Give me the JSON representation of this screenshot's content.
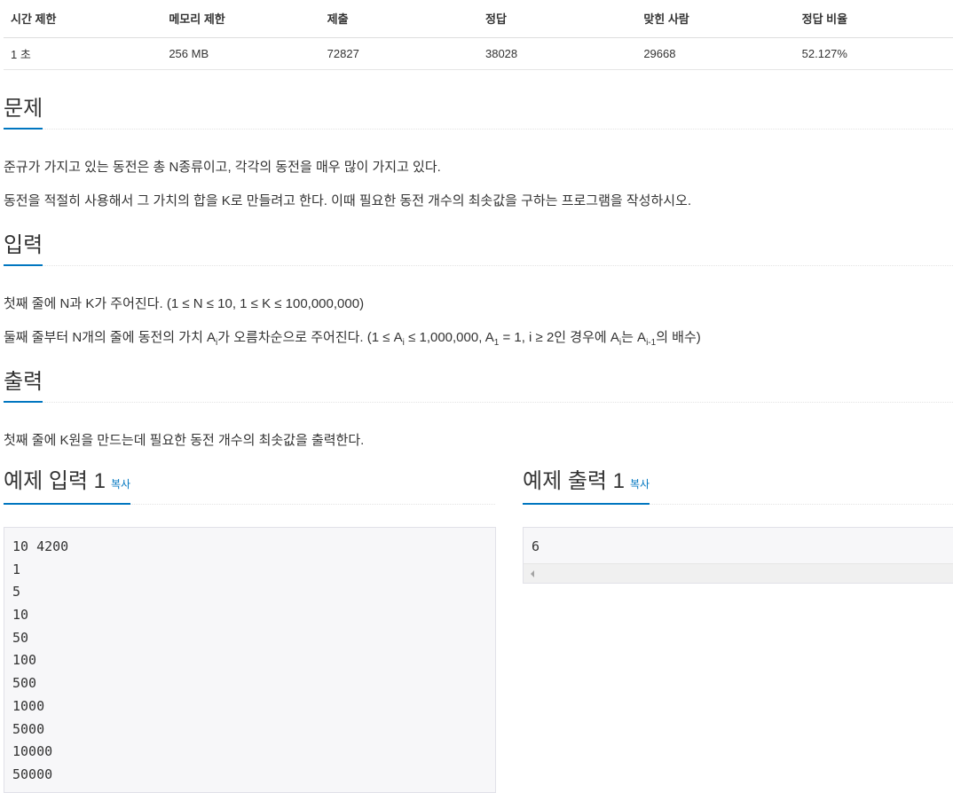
{
  "stats": {
    "headers": [
      "시간 제한",
      "메모리 제한",
      "제출",
      "정답",
      "맞힌 사람",
      "정답 비율"
    ],
    "values": [
      "1 초",
      "256 MB",
      "72827",
      "38028",
      "29668",
      "52.127%"
    ]
  },
  "problem": {
    "title": "문제",
    "p1": "준규가 가지고 있는 동전은 총 N종류이고, 각각의 동전을 매우 많이 가지고 있다.",
    "p2": "동전을 적절히 사용해서 그 가치의 합을 K로 만들려고 한다. 이때 필요한 동전 개수의 최솟값을 구하는 프로그램을 작성하시오."
  },
  "input": {
    "title": "입력",
    "p1": "첫째 줄에 N과 K가 주어진다. (1 ≤ N ≤ 10, 1 ≤ K ≤ 100,000,000)",
    "p2": {
      "t1": "둘째 줄부터 N개의 줄에 동전의 가치 A",
      "s1": "i",
      "t2": "가 오름차순으로 주어진다. (1 ≤ A",
      "s2": "i",
      "t3": " ≤ 1,000,000, A",
      "s3": "1",
      "t4": " = 1, i ≥ 2인 경우에 A",
      "s4": "i",
      "t5": "는 A",
      "s5": "i-1",
      "t6": "의 배수)"
    }
  },
  "output": {
    "title": "출력",
    "p1": "첫째 줄에 K원을 만드는데 필요한 동전 개수의 최솟값을 출력한다."
  },
  "sample_input": {
    "title": "예제 입력 1",
    "copy": "복사",
    "lines": [
      "10 4200",
      "1",
      "5",
      "10",
      "50",
      "100",
      "500",
      "1000",
      "5000",
      "10000",
      "50000"
    ]
  },
  "sample_output": {
    "title": "예제 출력 1",
    "copy": "복사",
    "lines": [
      "6"
    ]
  }
}
